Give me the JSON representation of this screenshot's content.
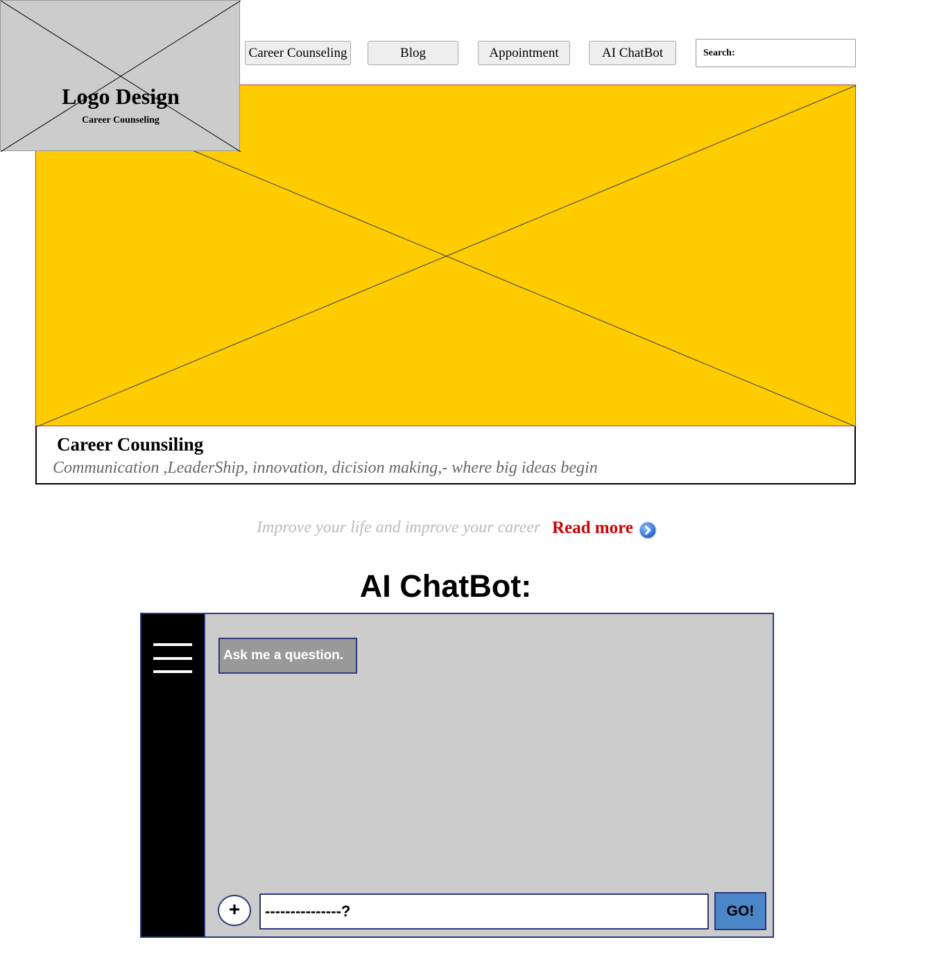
{
  "logo": {
    "title": "Logo Design",
    "subtitle": "Career Counseling"
  },
  "nav": {
    "items": [
      {
        "label": "Career Counseling"
      },
      {
        "label": "Blog"
      },
      {
        "label": "Appointment"
      },
      {
        "label": "AI ChatBot"
      }
    ]
  },
  "search": {
    "label": "Search:",
    "value": ""
  },
  "hero": {
    "title": "Career Counsiling",
    "subtitle": "Communication ,LeaderShip, innovation, dicision making,- where big ideas begin"
  },
  "promo": {
    "tagline": "Improve your life and improve your career",
    "read_more": "Read more"
  },
  "chatbot": {
    "heading": "AI ChatBot:",
    "bot_message": "Ask me a question.",
    "input_value": "---------------?",
    "attach_label": "+",
    "send_label": "GO!"
  },
  "colors": {
    "hero_background": "#ffcc00",
    "placeholder_gray": "#cccccc",
    "read_more": "#cc0000",
    "send_button": "#4a86c8",
    "frame_border": "#2b3a7a"
  }
}
